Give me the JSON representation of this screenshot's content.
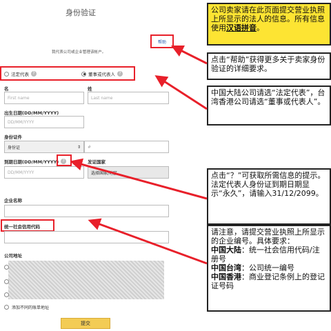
{
  "form": {
    "title": "身份验证",
    "intro": "我代表公司或企业管理该帐户。",
    "help_label": "帮助",
    "roles": [
      "法定代表",
      "董事或代表人"
    ],
    "first_name": {
      "label": "名",
      "placeholder": "First name"
    },
    "last_name": {
      "label": "姓",
      "placeholder": "Last name"
    },
    "birth_date": {
      "label": "出生日期(DD/MM/YYYY)",
      "placeholder": "DD/MM/YYYY"
    },
    "id_doc": {
      "label": "身份证件",
      "selected": "身份证",
      "number_placeholder": "#"
    },
    "expiry": {
      "label": "到期日期(DD/MM/YYYY)",
      "placeholder": "DD/MM/YYYY"
    },
    "country": {
      "label": "发证国家",
      "selected": "选择国家/地区"
    },
    "company_name": {
      "label": "企业名称"
    },
    "credit_code": {
      "label": "统一社会信用代码"
    },
    "address": {
      "label": "公司地址",
      "other_billing": "添加不同的账单地址"
    },
    "submit_label": "提交"
  },
  "notes": {
    "n1_text": "公司卖家请在此页面提交营业执照上所显示的法人的信息。所有信息使用",
    "n1_highlight": "汉语拼音",
    "n1_tail": "。",
    "n2": "点击“帮助”获得更多关于卖家身份验证的详细要求。",
    "n3": "中国大陆公司请选“法定代表”，台湾香港公司请选“董事或代表人”。",
    "n4": "点击“？”可获取所需信息的提示。法定代表人身份证到期日期显示“永久”，请输入31/12/2099。",
    "n5_intro": "请注意，请提交营业执照上所显示的企业编号。具体要求：",
    "n5_mainland_label": "中国大陆",
    "n5_mainland": "：统一社会信用代码/注册号",
    "n5_taiwan_label": "中国台湾",
    "n5_taiwan": "：公司统一编号",
    "n5_hk_label": "中国香港",
    "n5_hk": "：商业登记条例上的登记证号码"
  },
  "colors": {
    "highlight_red": "#e8202a",
    "note_yellow": "#fde433",
    "submit_yellow": "#f3cc55"
  }
}
